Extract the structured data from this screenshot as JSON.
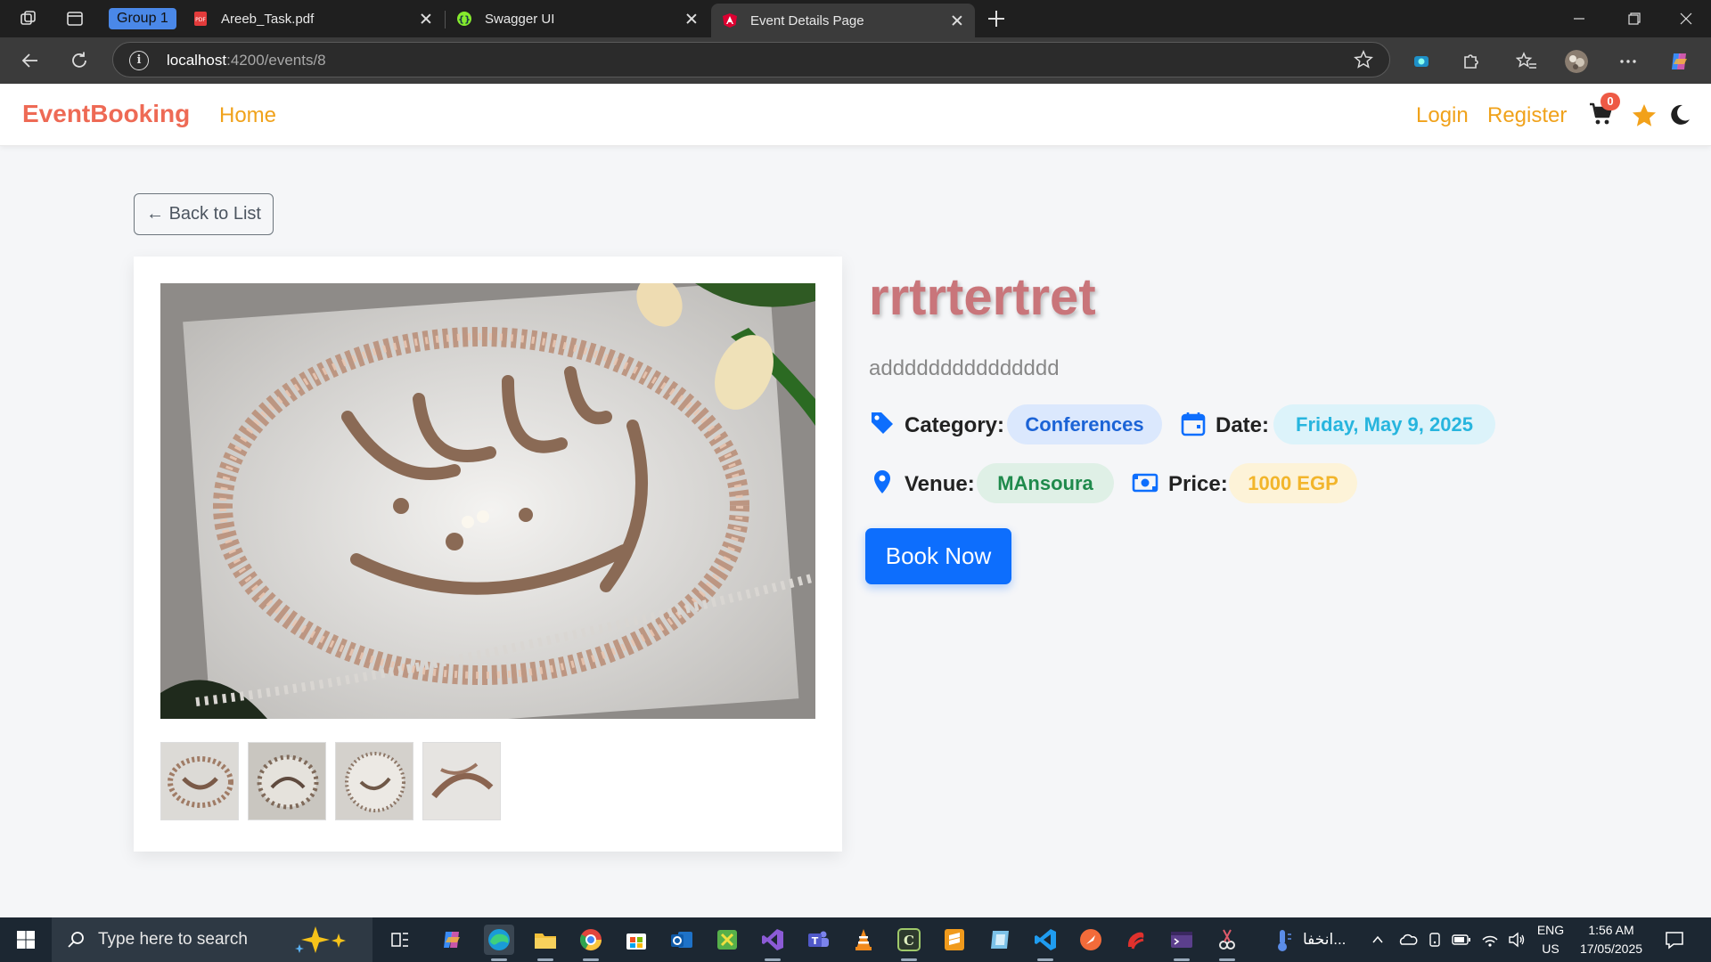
{
  "browser": {
    "group_label": "Group 1",
    "tabs": [
      {
        "title": "Areeb_Task.pdf"
      },
      {
        "title": "Swagger UI"
      },
      {
        "title": "Event Details Page"
      }
    ],
    "url_host": "localhost",
    "url_rest": ":4200/events/8"
  },
  "navbar": {
    "brand": "EventBooking",
    "home": "Home",
    "login": "Login",
    "register": "Register",
    "cart_count": "0"
  },
  "event": {
    "back_label": "← Back to List",
    "title": "rrtrtertret",
    "description": "addddddddddddddd",
    "category_label": "Category:",
    "category": "Conferences",
    "date_label": "Date:",
    "date": "Friday, May 9, 2025",
    "venue_label": "Venue:",
    "venue": "MAnsoura",
    "price_label": "Price:",
    "price": "1000 EGP",
    "book_label": "Book Now",
    "thumbnail_count": 4
  },
  "colors": {
    "brand": "#ee6a55",
    "nav_link": "#f0a21b",
    "title": "#c9757a",
    "primary": "#0d6efd",
    "category_chip_bg": "#dbe8fd",
    "date_chip_bg": "#dcf3fa",
    "venue_chip_bg": "#dff0e6",
    "price_chip_bg": "#fdf3d8"
  },
  "taskbar": {
    "search_placeholder": "Type here to search",
    "pinned_label": "انخفا...",
    "lang_top": "ENG",
    "lang_bottom": "US",
    "time": "1:56 AM",
    "date": "17/05/2025"
  }
}
